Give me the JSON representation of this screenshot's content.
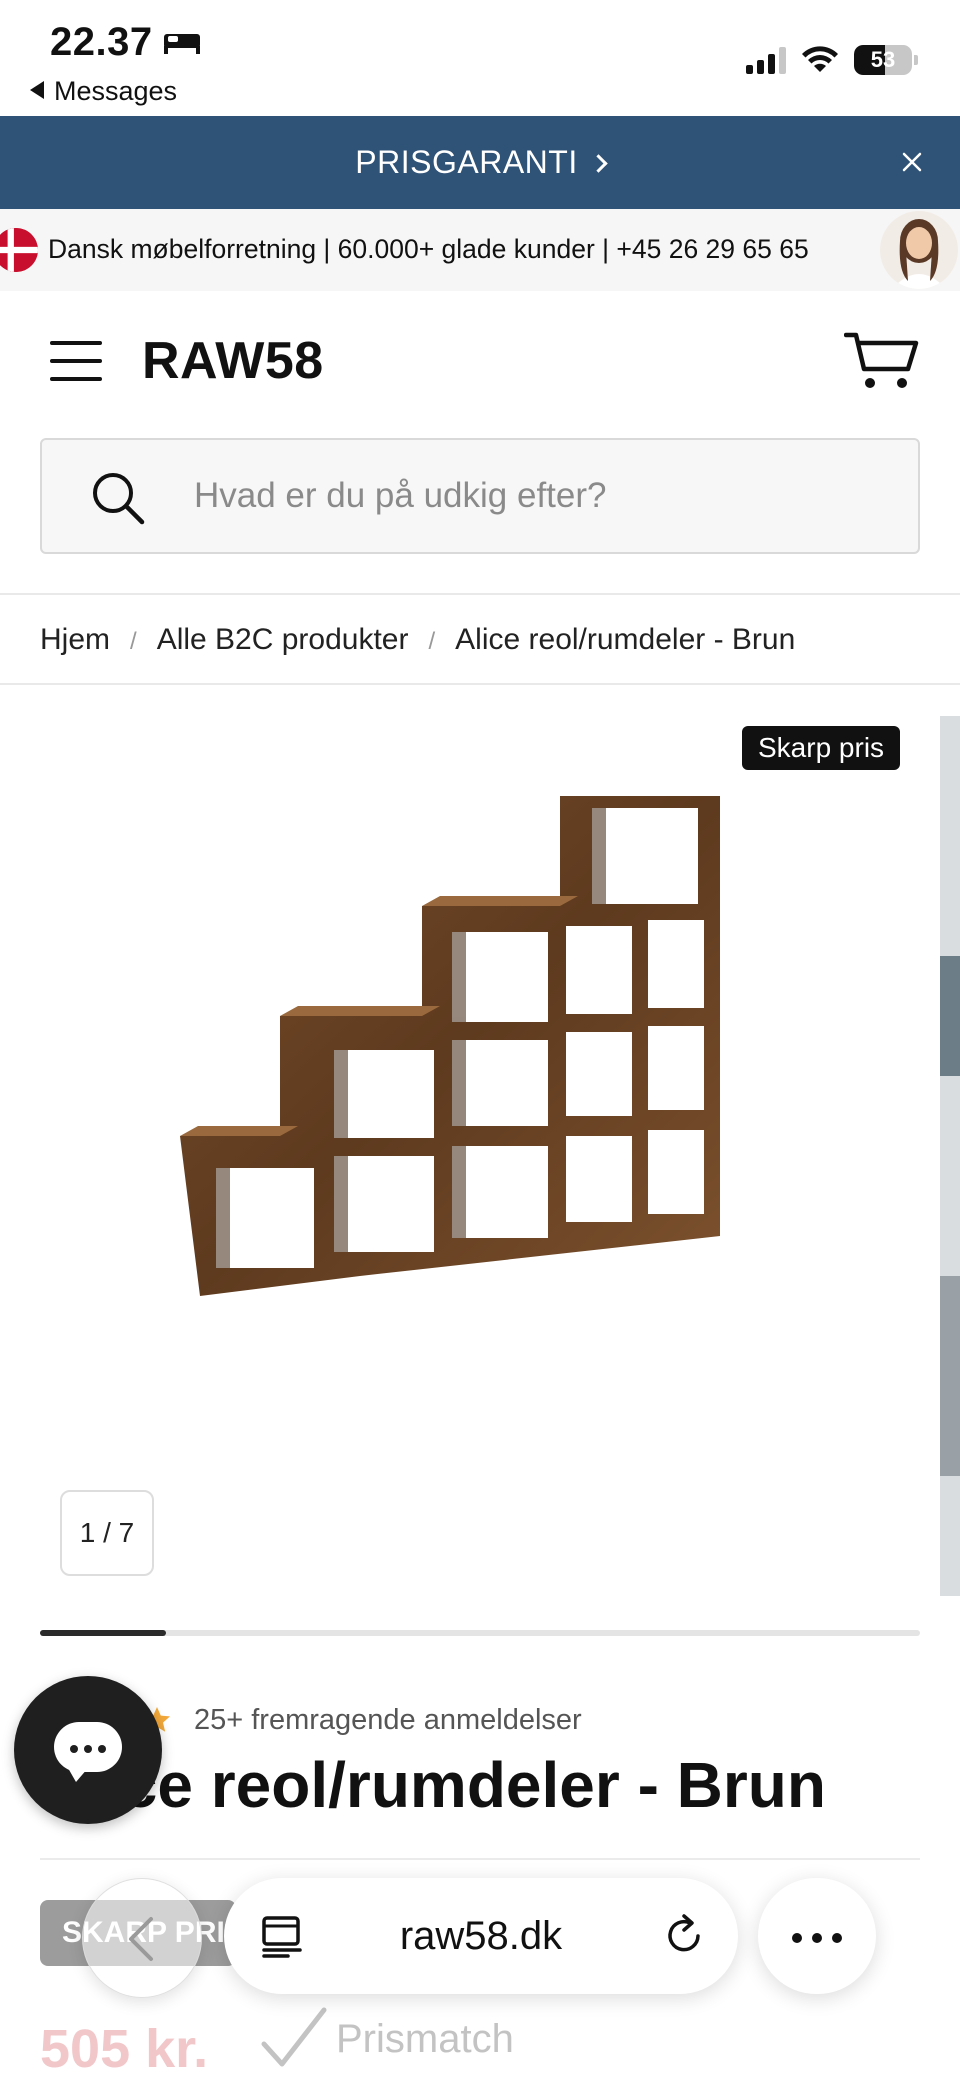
{
  "status_bar": {
    "time": "22.37",
    "back_app": "Messages",
    "battery_percent": "53",
    "battery_level": 0.53,
    "signal_bars": 3
  },
  "promo_banner": {
    "label": "PRISGARANTI"
  },
  "announcement": {
    "text": "Dansk møbelforretning | 60.000+ glade kunder | +45 26 29 65 65"
  },
  "header": {
    "logo": "RAW58",
    "search_placeholder": "Hvad er du på udkig efter?"
  },
  "breadcrumb": {
    "items": [
      "Hjem",
      "Alle B2C produkter",
      "Alice reol/rumdeler - Brun"
    ],
    "separator": "/"
  },
  "gallery": {
    "badge": "Skarp pris",
    "counter": "1 / 7",
    "current_image": 1,
    "total_images": 7
  },
  "product": {
    "reviews_text": "25+ fremragende anmeldelser",
    "title": "Alice reol/rumdeler - Brun",
    "sale_badge": "SKARP PRIS",
    "price": "505 kr.",
    "prismatch": "Prismatch"
  },
  "browser": {
    "url": "raw58.dk"
  },
  "colors": {
    "promo_bg": "#2f5277",
    "star": "#f2a83a",
    "price": "#f1c7c9",
    "wood": "#6b4425"
  },
  "icons": {
    "promo_close": "close-icon",
    "menu": "hamburger-icon",
    "cart": "cart-icon",
    "search": "search-icon",
    "chat": "chat-icon",
    "back": "chevron-left-icon",
    "reader": "reader-icon",
    "reload": "reload-icon",
    "more": "more-icon"
  }
}
